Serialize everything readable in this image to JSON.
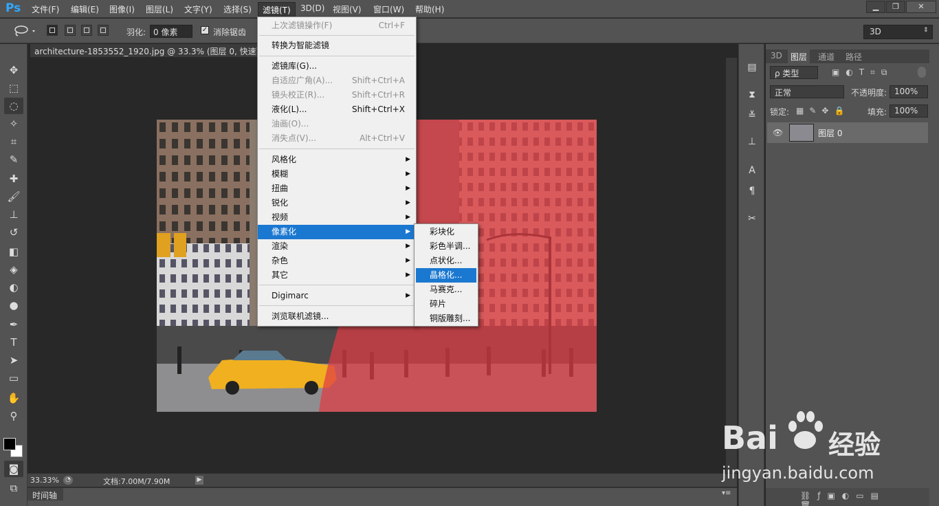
{
  "app": {
    "logo": "Ps"
  },
  "menubar": {
    "items": [
      "文件(F)",
      "编辑(E)",
      "图像(I)",
      "图层(L)",
      "文字(Y)",
      "选择(S)",
      "滤镜(T)",
      "3D(D)",
      "视图(V)",
      "窗口(W)",
      "帮助(H)"
    ]
  },
  "window": {
    "minimize": "▁",
    "restore": "❐",
    "close": "✕"
  },
  "options": {
    "feather_label": "羽化:",
    "feather_value": "0 像素",
    "antialias_label": "消除锯齿",
    "workspace": "3D",
    "lasso_icon": "lasso-icon"
  },
  "document": {
    "tab_title": "architecture-1853552_1920.jpg @ 33.3% (图层 0, 快速蒙版"
  },
  "status": {
    "zoom": "33.33%",
    "doc_info": "文档:7.00M/7.90M"
  },
  "timeline": {
    "label": "时间轴"
  },
  "filter_menu": {
    "last_filter": {
      "label": "上次滤镜操作(F)",
      "shortcut": "Ctrl+F"
    },
    "smart": "转换为智能滤镜",
    "gallery": "滤镜库(G)...",
    "adaptive": {
      "label": "自适应广角(A)...",
      "shortcut": "Shift+Ctrl+A"
    },
    "lens": {
      "label": "镜头校正(R)...",
      "shortcut": "Shift+Ctrl+R"
    },
    "liquify": {
      "label": "液化(L)...",
      "shortcut": "Shift+Ctrl+X"
    },
    "oil": "油画(O)...",
    "vanish": {
      "label": "消失点(V)...",
      "shortcut": "Alt+Ctrl+V"
    },
    "groups": [
      "风格化",
      "模糊",
      "扭曲",
      "锐化",
      "视频",
      "像素化",
      "渲染",
      "杂色",
      "其它"
    ],
    "digimarc": "Digimarc",
    "browse": "浏览联机滤镜..."
  },
  "pixelate_submenu": [
    "彩块化",
    "彩色半调...",
    "点状化...",
    "晶格化...",
    "马赛克...",
    "碎片",
    "铜版雕刻..."
  ],
  "layers_panel": {
    "tabs": [
      "3D",
      "图层",
      "通道",
      "路径"
    ],
    "filter_kind": "ρ 类型",
    "blend_mode": "正常",
    "opacity_label": "不透明度:",
    "opacity": "100%",
    "lock_label": "锁定:",
    "fill_label": "填充:",
    "fill": "100%",
    "layer_name": "图层 0"
  },
  "watermark": {
    "brand": "Bai",
    "brand2": "经验",
    "url": "jingyan.baidu.com"
  },
  "colors": {
    "highlight": "#1b78d0",
    "quickmask": "#e03c44",
    "ps_blue": "#31a8ff"
  }
}
